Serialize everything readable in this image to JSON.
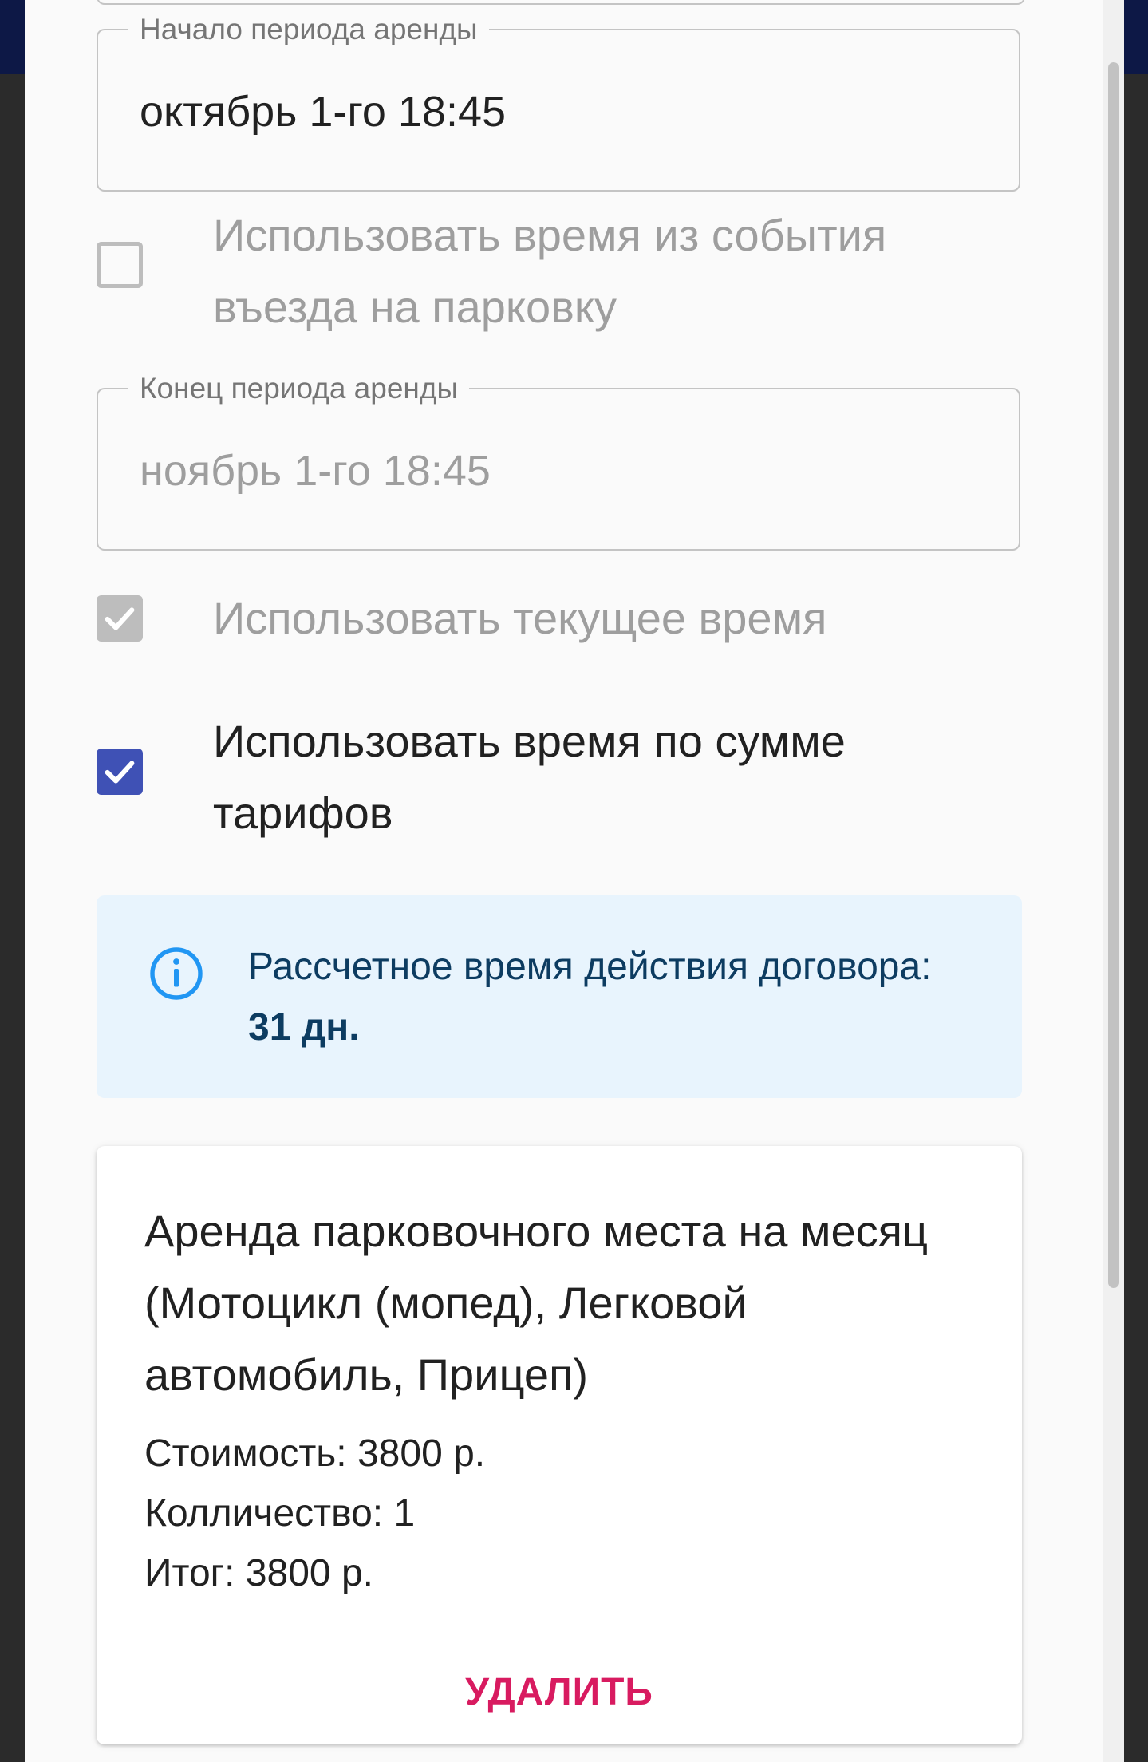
{
  "start_field": {
    "label": "Начало периода аренды",
    "value": "октябрь 1-го 18:45"
  },
  "entry_time_checkbox": {
    "label": "Использовать время из события въезда на парковку",
    "checked": false
  },
  "end_field": {
    "label": "Конец периода аренды",
    "value": "ноябрь 1-го 18:45",
    "disabled": true
  },
  "current_time_checkbox": {
    "label": "Использовать текущее время",
    "checked": true,
    "disabled": true
  },
  "tariff_sum_checkbox": {
    "label": "Использовать время по сумме тарифов",
    "checked": true
  },
  "info_alert": {
    "icon": "info-icon",
    "text_prefix": "Рассчетное время действия договора: ",
    "text_value": "31 дн."
  },
  "tariff_card": {
    "title": "Аренда парковочного места на месяц (Мотоцикл (мопед), Легковой автомобиль, Прицеп)",
    "cost": "Стоимость: 3800 р.",
    "quantity": "Колличество: 1",
    "total": "Итог: 3800 р.",
    "delete_label": "УДАЛИТЬ"
  },
  "colors": {
    "accent": "#3f51b5",
    "danger": "#d81b60",
    "info_bg": "#e8f4fd",
    "info_icon": "#2196f3",
    "header": "#0d1846"
  }
}
